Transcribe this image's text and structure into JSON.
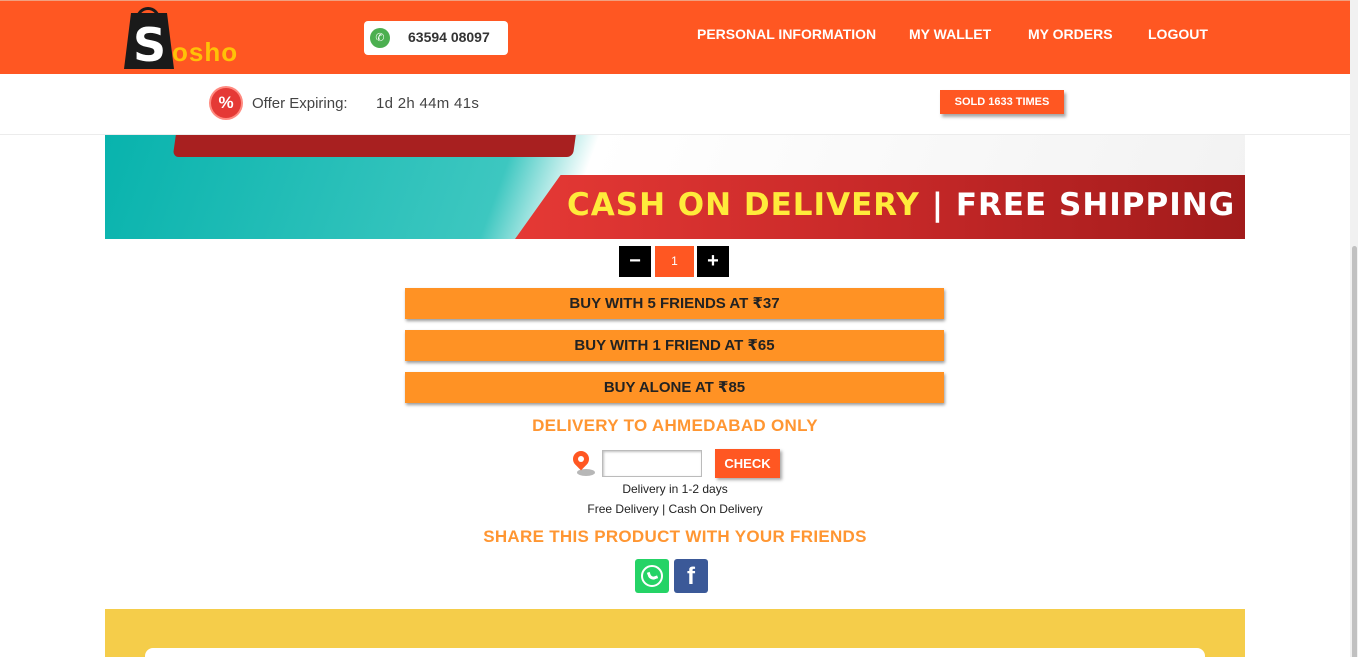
{
  "brand": {
    "logo_initial": "S",
    "logo_rest": "osho"
  },
  "header": {
    "whatsapp_number": "63594 08097",
    "nav": [
      "PERSONAL INFORMATION",
      "MY WALLET",
      "MY ORDERS",
      "LOGOUT"
    ]
  },
  "offer": {
    "icon_text": "%",
    "label": "Offer Expiring:",
    "timer": "1d 2h 44m 41s",
    "sold": "SOLD 1633 TIMES"
  },
  "banner": {
    "part1": "CASH ON DELIVERY",
    "separator": "|",
    "part2": "FREE SHIPPING"
  },
  "quantity": {
    "minus": "−",
    "value": "1",
    "plus": "+"
  },
  "buy_options": [
    "BUY WITH 5 FRIENDS AT ₹37",
    "BUY WITH 1 FRIEND AT ₹65",
    "BUY ALONE AT ₹85"
  ],
  "delivery": {
    "title": "DELIVERY TO AHMEDABAD ONLY",
    "pincode_value": "",
    "check_label": "CHECK",
    "eta": "Delivery in 1-2 days",
    "terms": "Free Delivery | Cash On Delivery"
  },
  "share": {
    "title": "SHARE THIS PRODUCT WITH YOUR FRIENDS",
    "facebook_glyph": "f"
  },
  "colors": {
    "header": "#ff5722",
    "accent_orange": "#ff9224",
    "title_orange": "#ff9632",
    "yellow_section": "#f5cd4a"
  }
}
